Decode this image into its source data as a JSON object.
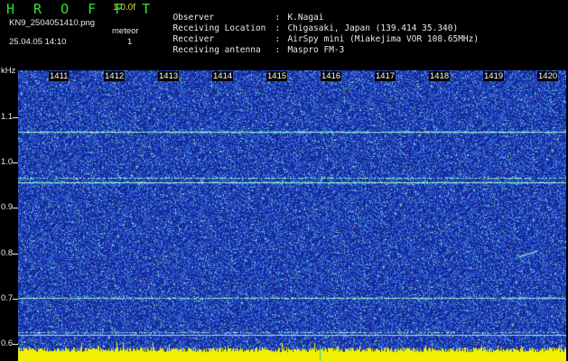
{
  "app": {
    "logo": "HROFFT",
    "version": "1.0.0f"
  },
  "file_name": "KN9_2504051410.png",
  "meteor_label": "meteor",
  "timestamp": "25.04.05 14:10",
  "meteor_count": "1",
  "info": [
    {
      "key": "Observer",
      "value": "K.Nagai"
    },
    {
      "key": "Receiving Location",
      "value": "Chigasaki, Japan (139.414 35.340)"
    },
    {
      "key": "Receiver",
      "value": "AirSpy mini (Miakejima VOR 108.65MHz)"
    },
    {
      "key": "Receiving antenna",
      "value": "Maspro FM-3"
    }
  ],
  "y_axis": {
    "unit": "kHz",
    "ticks": [
      "1.1",
      "1.0",
      "0.9",
      "0.8",
      "0.7",
      "0.6"
    ],
    "range": [
      0.58,
      1.18
    ]
  },
  "x_axis": {
    "ticks": [
      "1411",
      "1412",
      "1413",
      "1414",
      "1415",
      "1416",
      "1417",
      "1418",
      "1419",
      "1420"
    ]
  },
  "colors": {
    "background": "#000000",
    "spectrogram": "#1a2fb0",
    "noise_floor": "#f0f000",
    "logo": "#33e033",
    "version": "#d8d830",
    "carrier": "#40ffd0"
  }
}
